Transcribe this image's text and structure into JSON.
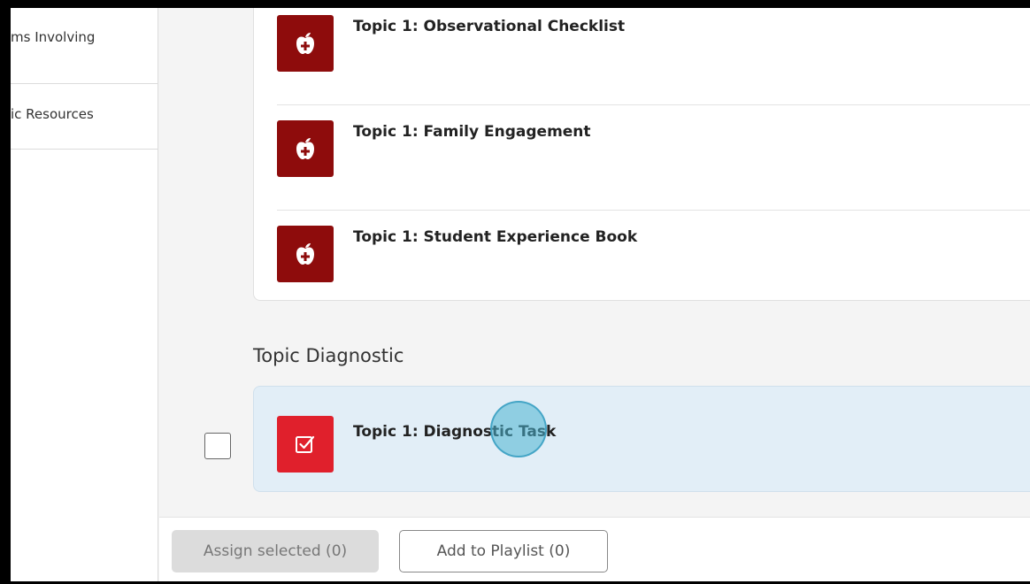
{
  "sidebar": {
    "items": [
      {
        "label": "ms Involving"
      },
      {
        "label": "ic Resources"
      }
    ]
  },
  "resources": [
    {
      "title": "Topic 1: Observational Checklist",
      "icon": "apple-plus-icon"
    },
    {
      "title": "Topic 1: Family Engagement",
      "icon": "apple-plus-icon"
    },
    {
      "title": "Topic 1: Student Experience Book",
      "icon": "apple-plus-icon"
    }
  ],
  "diagnostic": {
    "heading": "Topic Diagnostic",
    "item_title": "Topic 1: Diagnostic Task",
    "icon": "checkbox-check-icon"
  },
  "actions": {
    "assign_label": "Assign selected (0)",
    "playlist_label": "Add to Playlist (0)"
  },
  "colors": {
    "resource_icon_bg": "#8e0c0c",
    "diagnostic_icon_bg": "#e0202c",
    "selected_card_bg": "#e2eef7"
  }
}
